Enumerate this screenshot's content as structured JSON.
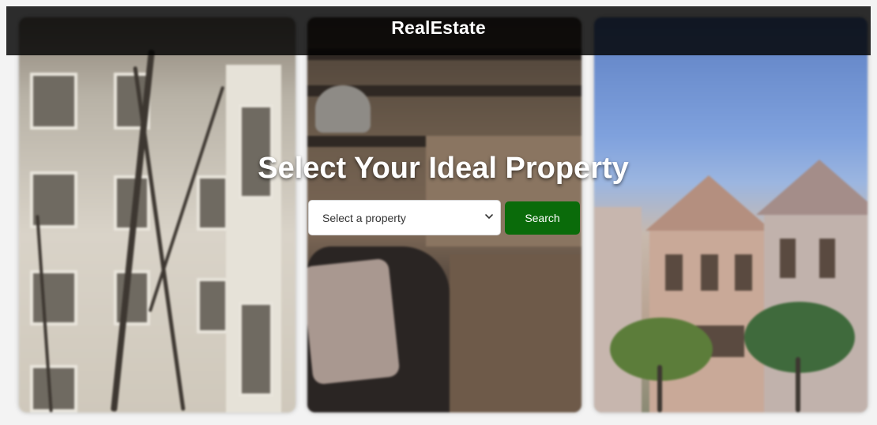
{
  "header": {
    "brand": "RealEstate"
  },
  "hero": {
    "title": "Select Your Ideal Property"
  },
  "search": {
    "select_placeholder": "Select a property",
    "button_label": "Search"
  },
  "colors": {
    "navbar_bg": "#000000",
    "button_bg": "#0a6b0a",
    "text_light": "#ffffff"
  },
  "icons": {
    "dropdown": "chevron-down-icon"
  }
}
